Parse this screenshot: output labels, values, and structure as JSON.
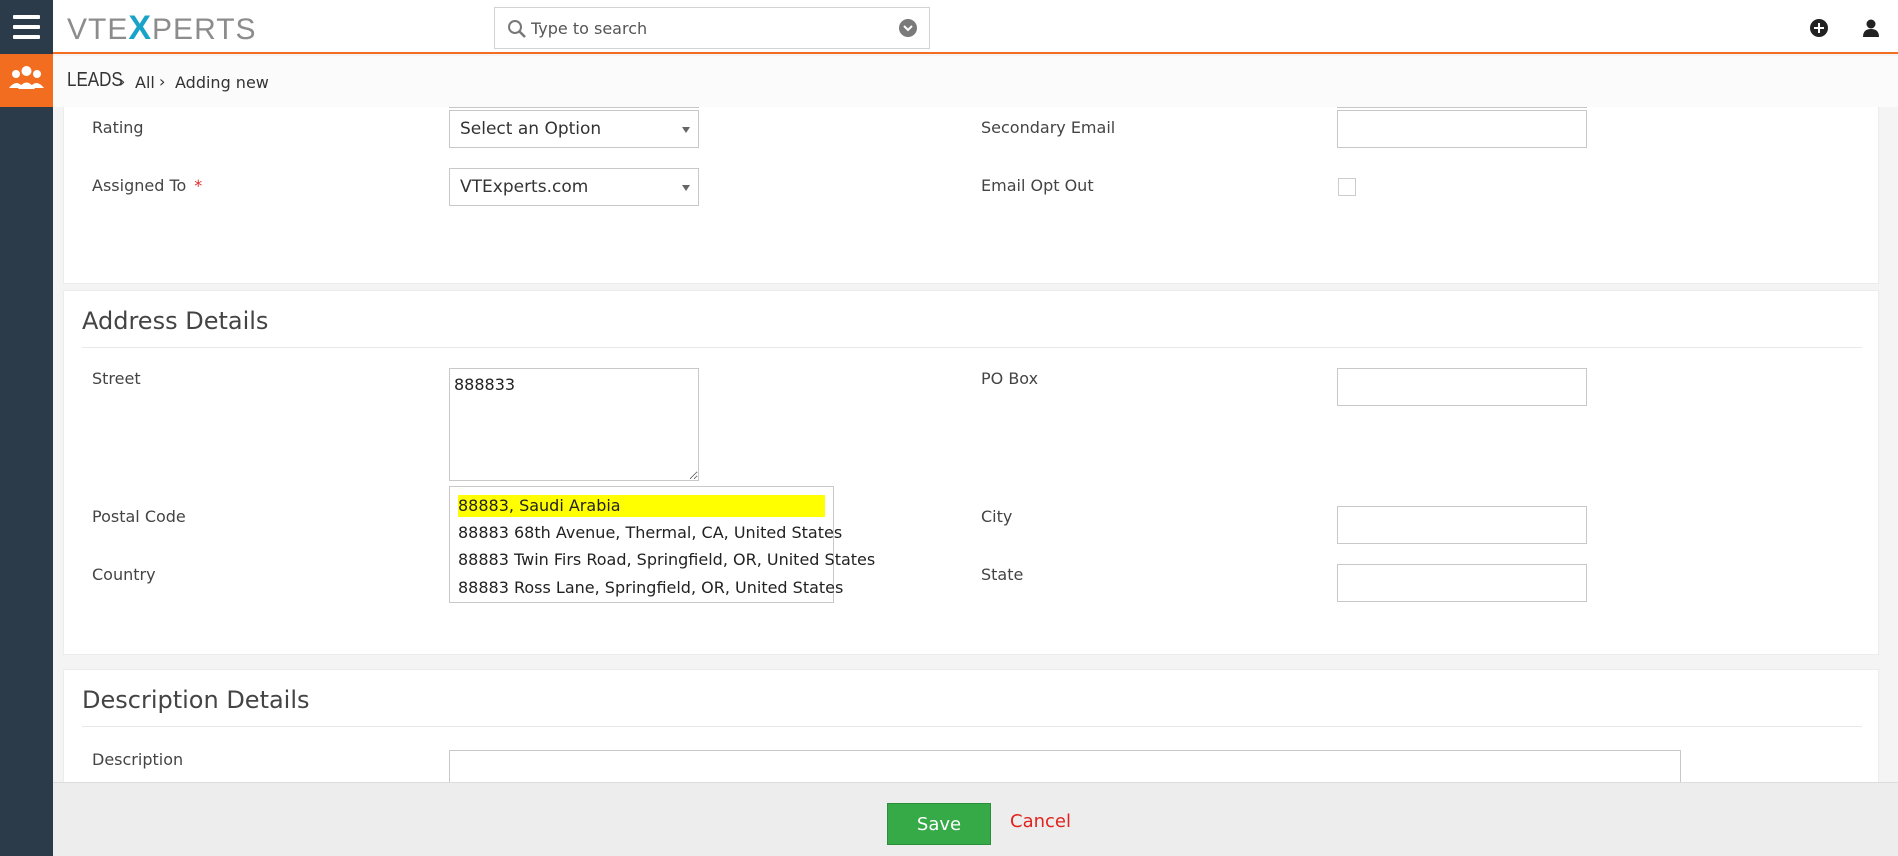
{
  "header": {
    "logo_left": "VTE",
    "logo_x": "X",
    "logo_right": "PERTS",
    "search_placeholder": "Type to search"
  },
  "breadcrumb": {
    "module": "LEADS",
    "level1": "All",
    "level2": "Adding new"
  },
  "lead_info": {
    "rating_label": "Rating",
    "rating_value": "Select an Option",
    "assigned_label": "Assigned To",
    "assigned_required": "*",
    "assigned_value": "VTExperts.com",
    "secondary_email_label": "Secondary Email",
    "email_opt_out_label": "Email Opt Out"
  },
  "address": {
    "title": "Address Details",
    "street_label": "Street",
    "street_value": "888833",
    "postal_label": "Postal Code",
    "country_label": "Country",
    "pobox_label": "PO Box",
    "city_label": "City",
    "state_label": "State",
    "suggestions": [
      "88883, Saudi Arabia",
      "88883 68th Avenue, Thermal, CA, United States",
      "88883 Twin Firs Road, Springfield, OR, United States",
      "88883 Ross Lane, Springfield, OR, United States"
    ]
  },
  "description": {
    "title": "Description Details",
    "label": "Description"
  },
  "footer": {
    "save": "Save",
    "cancel": "Cancel"
  },
  "colors": {
    "accent": "#f36d21",
    "sidebar": "#2c3b49",
    "save": "#35aa47",
    "cancel": "#e0231f",
    "highlight": "#ffff00"
  }
}
